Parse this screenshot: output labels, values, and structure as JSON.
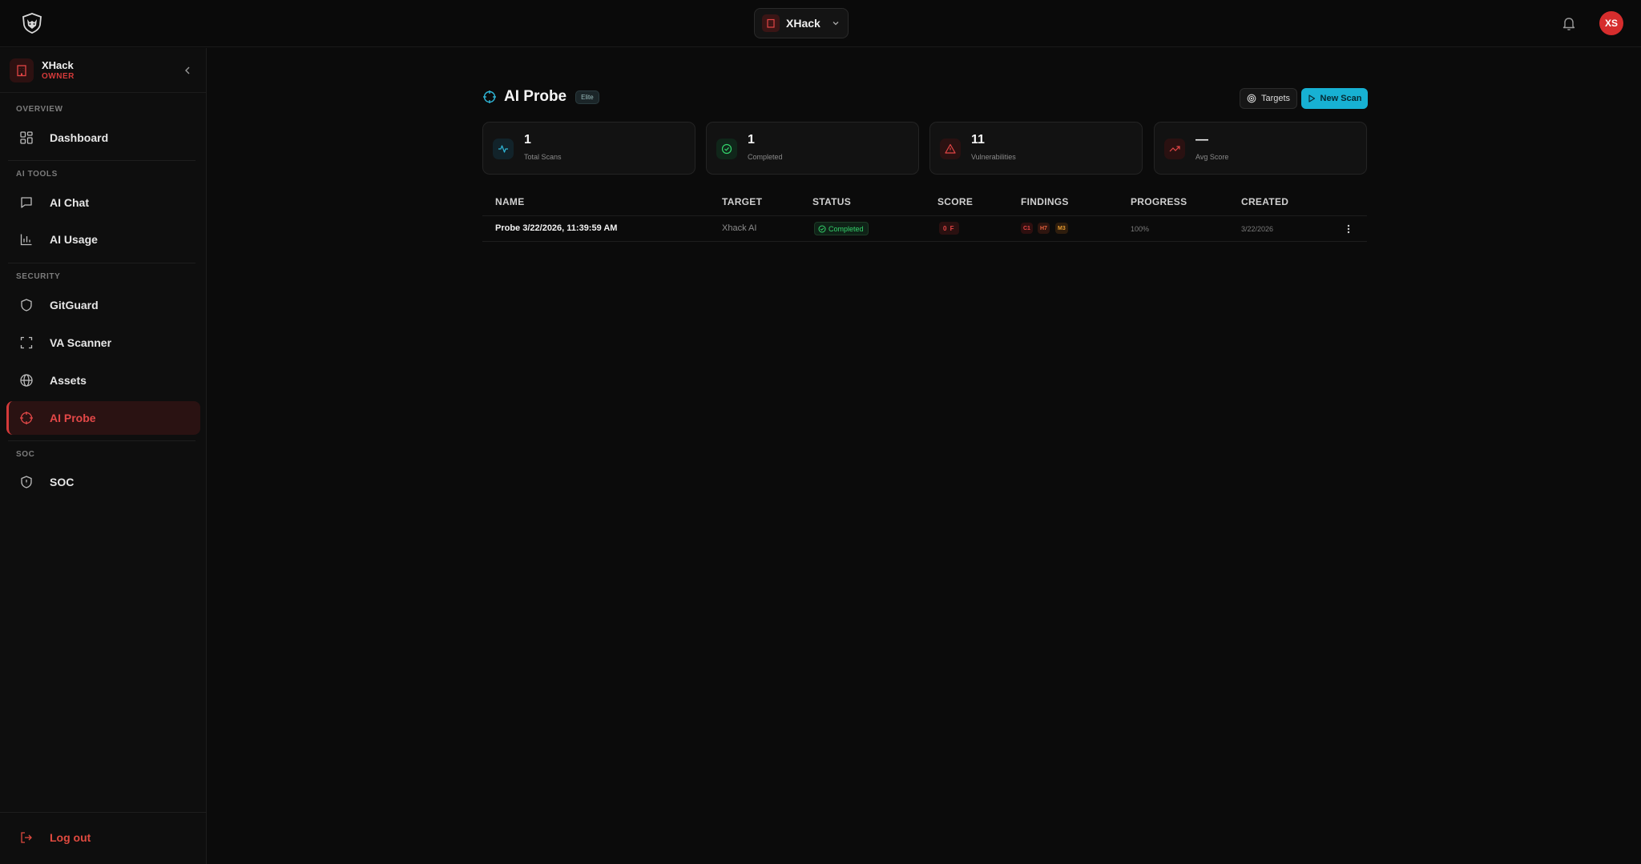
{
  "topbar": {
    "workspace_name": "XHack",
    "avatar_initials": "XS"
  },
  "sidebar": {
    "org_name": "XHack",
    "org_role": "OWNER",
    "sections": {
      "overview": "OVERVIEW",
      "ai_tools": "AI TOOLS",
      "security": "SECURITY",
      "soc": "SOC"
    },
    "items": {
      "dashboard": "Dashboard",
      "ai_chat": "AI Chat",
      "ai_usage": "AI Usage",
      "gitguard": "GitGuard",
      "va_scanner": "VA Scanner",
      "assets": "Assets",
      "ai_probe": "AI Probe",
      "soc": "SOC"
    },
    "active_item": "ai_probe",
    "logout_label": "Log out"
  },
  "main": {
    "title": "AI Probe",
    "tier_badge": "Elite",
    "targets_button": "Targets",
    "new_scan_button": "New Scan",
    "stats": [
      {
        "value": "1",
        "label": "Total Scans",
        "icon": "activity-icon"
      },
      {
        "value": "1",
        "label": "Completed",
        "icon": "check-circle-icon"
      },
      {
        "value": "11",
        "label": "Vulnerabilities",
        "icon": "warning-triangle-icon"
      },
      {
        "value": "—",
        "label": "Avg Score",
        "icon": "trending-up-icon"
      }
    ],
    "table": {
      "columns": [
        "NAME",
        "TARGET",
        "STATUS",
        "SCORE",
        "FINDINGS",
        "PROGRESS",
        "CREATED"
      ],
      "rows": [
        {
          "name": "Probe 3/22/2026, 11:39:59 AM",
          "target": "Xhack AI",
          "status": "Completed",
          "score": "0 F",
          "findings": [
            "C1",
            "H7",
            "M3"
          ],
          "progress": "100%",
          "created": "3/22/2026"
        }
      ]
    }
  },
  "colors": {
    "background": "#0b0b0b",
    "accent_red": "#d43a3a",
    "accent_cyan": "#17b1d3",
    "success_green": "#34d36b"
  }
}
